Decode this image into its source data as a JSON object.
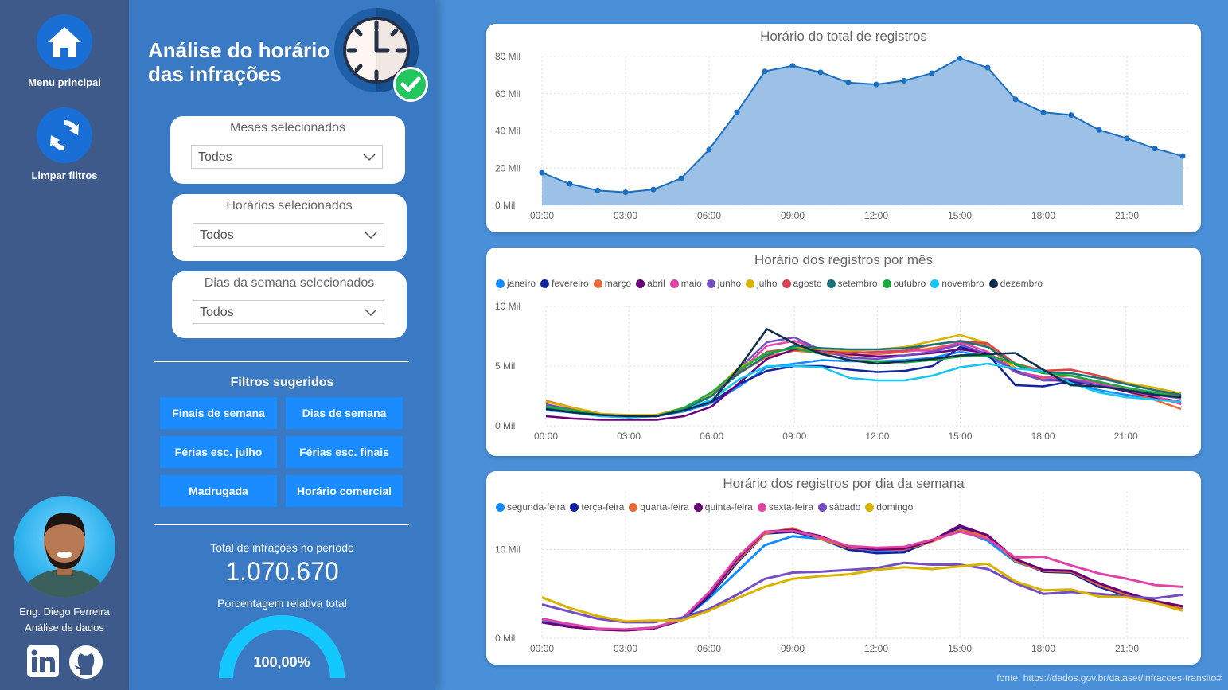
{
  "nav": {
    "home_label": "Menu principal",
    "clear_label": "Limpar filtros",
    "author_name": "Eng. Diego Ferreira",
    "author_role": "Análise de dados"
  },
  "panel": {
    "title_line1": "Análise do horário",
    "title_line2": "das infrações",
    "filters": [
      {
        "label": "Meses selecionados",
        "value": "Todos"
      },
      {
        "label": "Horários selecionados",
        "value": "Todos"
      },
      {
        "label": "Dias da semana selecionados",
        "value": "Todos"
      }
    ],
    "suggested_title": "Filtros sugeridos",
    "suggested": [
      "Finais de semana",
      "Dias de semana",
      "Férias esc. julho",
      "Férias esc. finais",
      "Madrugada",
      "Horário comercial"
    ],
    "kpi_label": "Total de infrações no período",
    "kpi_value": "1.070.670",
    "pct_label": "Porcentagem relativa total",
    "pct_value": "100,00%",
    "pct_fraction": 1.0
  },
  "source": "fonte: https://dados.gov.br/dataset/infracoes-transito#",
  "colors": {
    "area_line": "#1a6fc0",
    "area_fill": "#9cc0e6",
    "nav_bg": "#3d5a8a",
    "panel_bg": "#3a7ac4",
    "page_bg": "#4a90d9",
    "button": "#1a8cff",
    "gauge": "#12c8ff"
  },
  "chart_data": [
    {
      "type": "area",
      "title": "Horário do total de registros",
      "x_ticks": [
        "00:00",
        "03:00",
        "06:00",
        "09:00",
        "12:00",
        "15:00",
        "18:00",
        "21:00"
      ],
      "y_ticks": [
        "0 Mil",
        "20 Mil",
        "40 Mil",
        "60 Mil",
        "80 Mil"
      ],
      "ylim": [
        0,
        80
      ],
      "x_hours": [
        0,
        1,
        2,
        3,
        4,
        5,
        6,
        7,
        8,
        9,
        10,
        11,
        12,
        13,
        14,
        15,
        16,
        17,
        18,
        19,
        20,
        21,
        22,
        23
      ],
      "values": [
        17.5,
        11.5,
        8,
        7,
        8.5,
        14.5,
        30,
        50,
        72,
        75,
        71.5,
        66,
        65,
        67,
        71,
        79,
        74,
        57,
        50,
        48.5,
        40.5,
        36,
        30.5,
        26.5
      ],
      "grid": true
    },
    {
      "type": "line",
      "title": "Horário dos registros por mês",
      "x_ticks": [
        "00:00",
        "03:00",
        "06:00",
        "09:00",
        "12:00",
        "15:00",
        "18:00",
        "21:00"
      ],
      "y_ticks": [
        "0 Mil",
        "5 Mil",
        "10 Mil"
      ],
      "ylim": [
        0,
        10
      ],
      "legend_position": "top-left",
      "series": [
        {
          "name": "janeiro",
          "color": "#118dff",
          "values": [
            1.3,
            1.1,
            0.8,
            0.7,
            0.8,
            1.2,
            1.9,
            3.3,
            4.9,
            5.2,
            5.5,
            5.4,
            5.4,
            5.5,
            5.7,
            6.2,
            5.8,
            4.6,
            4.0,
            3.6,
            3.0,
            2.6,
            2.3,
            2.0
          ]
        },
        {
          "name": "fevereiro",
          "color": "#12239e",
          "values": [
            1.5,
            1.2,
            0.9,
            0.8,
            0.8,
            1.3,
            2.0,
            3.5,
            4.6,
            5.0,
            5.0,
            4.7,
            4.5,
            4.6,
            5.0,
            6.6,
            6.0,
            3.4,
            3.3,
            3.7,
            3.4,
            3.0,
            2.7,
            2.5
          ]
        },
        {
          "name": "março",
          "color": "#e66c37",
          "values": [
            2.1,
            1.5,
            1.0,
            0.8,
            0.9,
            1.5,
            2.6,
            4.4,
            5.8,
            6.3,
            6.1,
            5.9,
            6.0,
            6.2,
            6.5,
            6.9,
            6.8,
            4.5,
            4.0,
            4.2,
            3.6,
            2.9,
            2.2,
            1.4
          ]
        },
        {
          "name": "abril",
          "color": "#6b007b",
          "values": [
            0.8,
            0.6,
            0.5,
            0.5,
            0.5,
            0.8,
            1.6,
            3.6,
            5.6,
            6.4,
            6.3,
            6.0,
            5.8,
            5.9,
            6.1,
            6.4,
            6.1,
            4.6,
            3.8,
            3.8,
            3.4,
            2.9,
            2.4,
            2.0
          ]
        },
        {
          "name": "maio",
          "color": "#e044a7",
          "values": [
            1.7,
            1.4,
            0.9,
            0.8,
            0.8,
            1.4,
            2.5,
            4.5,
            6.7,
            7.1,
            6.4,
            6.2,
            6.1,
            6.3,
            6.3,
            7.0,
            6.2,
            4.5,
            4.1,
            3.9,
            3.6,
            3.0,
            2.5,
            1.8
          ]
        },
        {
          "name": "junho",
          "color": "#744ec2",
          "values": [
            1.8,
            1.3,
            0.9,
            0.8,
            0.9,
            1.5,
            2.7,
            4.8,
            7.0,
            7.4,
            6.3,
            5.7,
            5.6,
            5.9,
            6.2,
            6.8,
            6.0,
            4.5,
            3.8,
            3.9,
            3.4,
            3.0,
            2.6,
            2.3
          ]
        },
        {
          "name": "julho",
          "color": "#d9b300",
          "values": [
            2.0,
            1.5,
            1.0,
            0.9,
            0.9,
            1.5,
            2.7,
            4.9,
            6.0,
            6.6,
            6.4,
            6.3,
            6.4,
            6.6,
            7.1,
            7.6,
            6.9,
            4.8,
            4.6,
            4.7,
            4.2,
            3.6,
            3.2,
            2.7
          ]
        },
        {
          "name": "agosto",
          "color": "#d64550",
          "values": [
            1.6,
            1.3,
            0.9,
            0.8,
            0.8,
            1.4,
            2.5,
            4.6,
            6.2,
            6.5,
            6.1,
            6.1,
            6.2,
            6.3,
            6.8,
            7.1,
            6.9,
            5.2,
            4.6,
            4.7,
            4.2,
            3.5,
            3.0,
            2.5
          ]
        },
        {
          "name": "setembro",
          "color": "#197278",
          "values": [
            1.5,
            1.2,
            0.9,
            0.8,
            0.8,
            1.4,
            2.5,
            4.4,
            5.9,
            6.7,
            6.5,
            6.4,
            6.4,
            6.5,
            6.8,
            7.1,
            6.6,
            5.1,
            4.4,
            4.4,
            4.0,
            3.5,
            3.0,
            2.6
          ]
        },
        {
          "name": "outubro",
          "color": "#1aab40",
          "values": [
            1.6,
            1.3,
            0.9,
            0.8,
            0.8,
            1.5,
            2.8,
            4.7,
            6.1,
            6.5,
            6.0,
            5.5,
            5.4,
            5.3,
            5.5,
            5.8,
            5.9,
            5.2,
            4.4,
            4.2,
            3.7,
            3.2,
            2.8,
            2.4
          ]
        },
        {
          "name": "novembro",
          "color": "#15c6f4",
          "values": [
            1.4,
            1.1,
            0.8,
            0.7,
            0.8,
            1.3,
            2.2,
            3.9,
            5.0,
            5.0,
            4.9,
            4.0,
            3.8,
            3.8,
            4.2,
            4.9,
            5.2,
            4.8,
            4.6,
            3.6,
            2.8,
            2.4,
            2.2,
            2.0
          ]
        },
        {
          "name": "dezembro",
          "color": "#0f2e4f",
          "values": [
            1.4,
            1.1,
            0.9,
            0.8,
            0.8,
            1.3,
            2.0,
            4.9,
            8.1,
            6.9,
            6.0,
            5.5,
            5.2,
            5.4,
            5.6,
            5.9,
            6.0,
            6.1,
            4.7,
            3.4,
            3.3,
            3.0,
            2.6,
            2.4
          ]
        }
      ]
    },
    {
      "type": "line",
      "title": "Horário dos registros por dia da semana",
      "x_ticks": [
        "00:00",
        "03:00",
        "06:00",
        "09:00",
        "12:00",
        "15:00",
        "18:00",
        "21:00"
      ],
      "y_ticks": [
        "0 Mil",
        "10 Mil"
      ],
      "ylim": [
        0,
        16.5
      ],
      "legend_position": "top-left",
      "series": [
        {
          "name": "segunda-feira",
          "color": "#118dff",
          "values": [
            2.0,
            1.4,
            1.0,
            1.0,
            1.2,
            2.0,
            4.5,
            7.5,
            10.5,
            11.5,
            11.2,
            10.0,
            9.8,
            9.9,
            11.0,
            12.2,
            11.0,
            8.6,
            7.6,
            7.4,
            5.8,
            4.8,
            4.0,
            3.5
          ]
        },
        {
          "name": "terça-feira",
          "color": "#12239e",
          "values": [
            1.8,
            1.3,
            1.0,
            0.9,
            1.1,
            2.0,
            4.7,
            8.5,
            11.8,
            12.0,
            11.3,
            10.0,
            9.6,
            9.7,
            11.0,
            12.5,
            11.6,
            8.8,
            7.5,
            7.4,
            5.8,
            4.8,
            4.0,
            3.4
          ]
        },
        {
          "name": "quarta-feira",
          "color": "#e66c37",
          "values": [
            1.8,
            1.3,
            1.0,
            0.9,
            1.1,
            2.1,
            4.9,
            8.7,
            11.8,
            12.4,
            11.2,
            10.2,
            10.0,
            10.0,
            10.9,
            12.2,
            11.5,
            8.7,
            7.6,
            7.5,
            6.0,
            4.9,
            4.1,
            3.4
          ]
        },
        {
          "name": "quinta-feira",
          "color": "#6b007b",
          "values": [
            1.8,
            1.3,
            1.0,
            0.9,
            1.1,
            2.1,
            4.9,
            8.9,
            12.0,
            12.2,
            11.5,
            10.3,
            10.0,
            10.1,
            11.0,
            12.7,
            11.6,
            8.9,
            7.7,
            7.6,
            6.2,
            5.1,
            4.2,
            3.6
          ]
        },
        {
          "name": "sexta-feira",
          "color": "#e044a7",
          "values": [
            2.2,
            1.6,
            1.1,
            1.0,
            1.2,
            2.1,
            5.2,
            9.1,
            12.0,
            12.1,
            11.4,
            10.4,
            10.2,
            10.3,
            11.1,
            12.0,
            11.2,
            9.1,
            9.2,
            8.2,
            7.3,
            6.7,
            6.0,
            5.8
          ]
        },
        {
          "name": "sábado",
          "color": "#744ec2",
          "values": [
            3.8,
            3.0,
            2.2,
            1.8,
            1.8,
            2.3,
            3.3,
            4.9,
            6.7,
            7.4,
            7.5,
            7.7,
            7.9,
            8.5,
            8.3,
            8.3,
            7.8,
            6.2,
            5.0,
            5.2,
            5.0,
            4.7,
            4.5,
            4.9
          ]
        },
        {
          "name": "domingo",
          "color": "#d9b300",
          "values": [
            4.6,
            3.4,
            2.5,
            1.9,
            2.0,
            2.0,
            3.1,
            4.5,
            5.8,
            6.7,
            7.0,
            7.2,
            7.7,
            8.0,
            7.8,
            8.1,
            8.4,
            6.4,
            5.4,
            5.5,
            4.7,
            4.6,
            4.0,
            3.1
          ]
        }
      ]
    }
  ]
}
